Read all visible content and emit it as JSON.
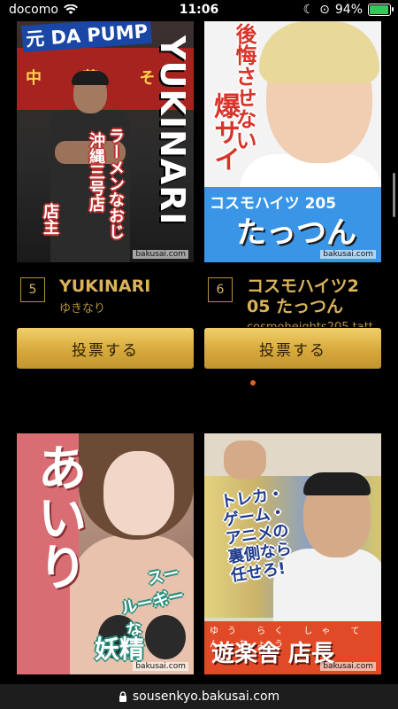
{
  "status": {
    "carrier": "docomo",
    "time": "11:06",
    "battery": "94%",
    "battery_level": 0.94,
    "icons": [
      "wifi-icon",
      "moon-icon",
      "orientation-lock-icon",
      "battery-icon"
    ]
  },
  "cards": [
    {
      "rank": "5",
      "name": "YUKINARI",
      "kana": "ゆきなり",
      "vote_label": "投票する",
      "image": {
        "top_title": "元 DA PUMP",
        "shop_sign": "中 華 そ",
        "vertical_name": "YUKINARI",
        "sub_line1": "ラーメンなおじ",
        "sub_line2": "沖縄三号店",
        "sub_line3": "店主",
        "watermark": "bakusai.com"
      }
    },
    {
      "rank": "6",
      "name_line1": "コスモハイツ2",
      "name_line2": "05 たっつん",
      "kana": "cosmoheights205 tatt",
      "vote_label": "投票する",
      "image": {
        "copy1": "後悔させない",
        "copy2": "爆サイ",
        "band_sub": "コスモハイツ 205",
        "band_name": "たっつん",
        "watermark": "bakusai.com"
      }
    },
    {
      "image": {
        "vertical_name": "あいり",
        "catch1": "スーパー",
        "catch2": "ルーキーな",
        "catch3": "妖精",
        "watermark": "bakusai.com"
      }
    },
    {
      "image": {
        "catch_lines": [
          "トレカ・",
          "ゲーム・",
          "アニメの",
          "裏側なら",
          "任せろ!"
        ],
        "ruby": "ゆう らく しゃ てん ちょう",
        "band_name": "遊楽舎 店長",
        "watermark": "bakusai.com"
      }
    }
  ],
  "url": "sousenkyo.bakusai.com",
  "colors": {
    "accent_gold": "#d9b25a",
    "button_gold": "#d7a93c",
    "background": "#000000"
  }
}
